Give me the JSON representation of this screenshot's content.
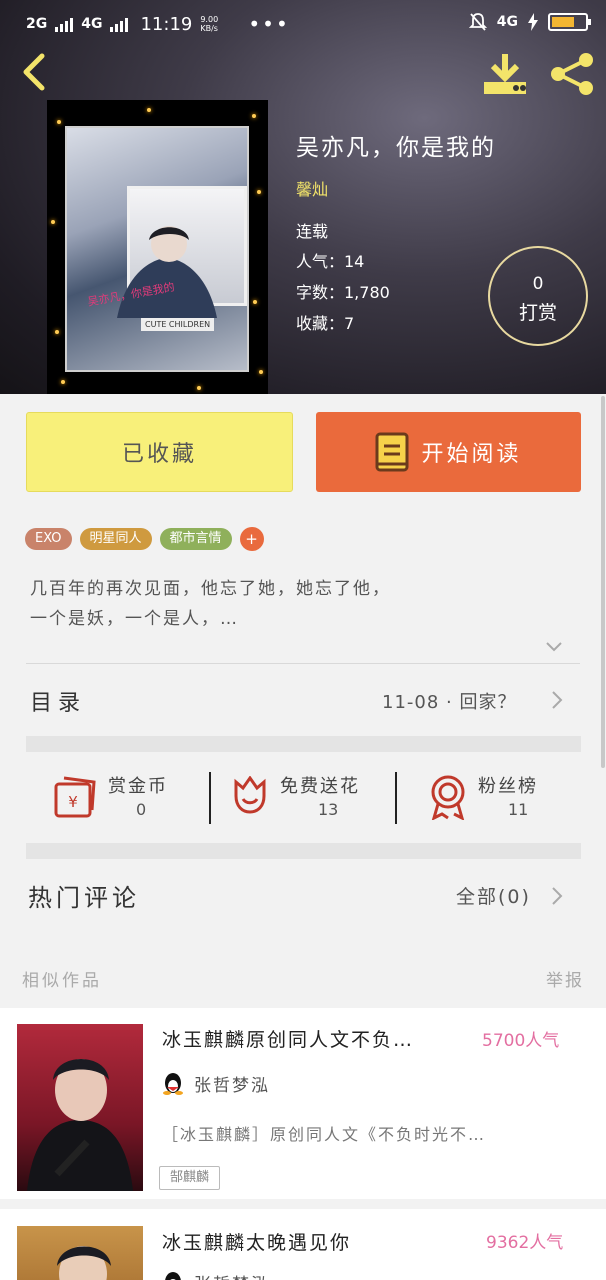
{
  "status_bar": {
    "net1": "2G",
    "net2": "4G",
    "time": "11:19",
    "speed_value": "9.00",
    "speed_unit": "KB/s",
    "more": "•••",
    "right_net": "4G",
    "battery_level": 0.7
  },
  "book": {
    "title": "吴亦凡，你是我的",
    "author": "馨灿",
    "status": "连载",
    "popularity": "人气：14",
    "word_count": "字数：1,780",
    "favorites": "收藏：7",
    "cover_text": "吴亦凡，你是我的",
    "cover_sub": "CUTE CHILDREN"
  },
  "reward": {
    "count": "0",
    "label": "打赏"
  },
  "actions": {
    "favorited": "已收藏",
    "start_reading": "开始阅读"
  },
  "tags": [
    {
      "label": "EXO",
      "color": "#c9836a"
    },
    {
      "label": "明星同人",
      "color": "#cf9a3f"
    },
    {
      "label": "都市言情",
      "color": "#8fb05b"
    }
  ],
  "tag_add": "+",
  "description": {
    "line1": "几百年的再次见面，他忘了她，她忘了他，",
    "line2": "一个是妖，一个是人，…"
  },
  "toc": {
    "label": "目录",
    "latest": "11-08 · 回家？"
  },
  "stats": [
    {
      "label": "赏金币",
      "value": "0",
      "icon": "coin-envelope-icon"
    },
    {
      "label": "免费送花",
      "value": "13",
      "icon": "flower-icon"
    },
    {
      "label": "粉丝榜",
      "value": "11",
      "icon": "medal-icon"
    }
  ],
  "comments": {
    "label": "热门评论",
    "all": "全部(0)"
  },
  "similar": {
    "label": "相似作品",
    "report": "举报"
  },
  "similar_items": [
    {
      "title": "冰玉麒麟原创同人文不负…",
      "popularity": "5700人气",
      "author": "张哲梦泓",
      "desc": "［冰玉麒麟］原创同人文《不负时光不…",
      "tag": "郜麒麟"
    },
    {
      "title": "冰玉麒麟太晚遇见你",
      "popularity": "9362人气",
      "author": "张哲梦泓"
    }
  ],
  "colors": {
    "accent_orange": "#ea6a3c",
    "fav_yellow": "#f8f07a",
    "header_yellow": "#f3e46a",
    "popularity_pink": "#e36fa1"
  }
}
